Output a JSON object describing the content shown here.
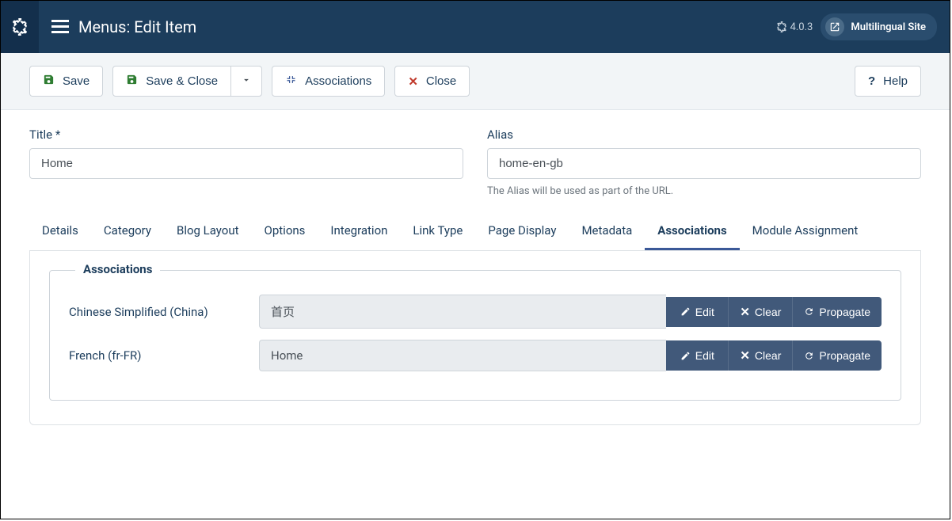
{
  "header": {
    "page_title": "Menus: Edit Item",
    "version": "4.0.3",
    "site_link": "Multilingual Site"
  },
  "toolbar": {
    "save": "Save",
    "save_close": "Save & Close",
    "associations": "Associations",
    "close": "Close",
    "help": "Help"
  },
  "form": {
    "title_label": "Title *",
    "title_value": "Home",
    "alias_label": "Alias",
    "alias_value": "home-en-gb",
    "alias_help": "The Alias will be used as part of the URL."
  },
  "tabs": [
    {
      "label": "Details",
      "active": false
    },
    {
      "label": "Category",
      "active": false
    },
    {
      "label": "Blog Layout",
      "active": false
    },
    {
      "label": "Options",
      "active": false
    },
    {
      "label": "Integration",
      "active": false
    },
    {
      "label": "Link Type",
      "active": false
    },
    {
      "label": "Page Display",
      "active": false
    },
    {
      "label": "Metadata",
      "active": false
    },
    {
      "label": "Associations",
      "active": true
    },
    {
      "label": "Module Assignment",
      "active": false
    }
  ],
  "associations": {
    "legend": "Associations",
    "buttons": {
      "edit": "Edit",
      "clear": "Clear",
      "propagate": "Propagate"
    },
    "rows": [
      {
        "label": "Chinese Simplified (China)",
        "value": "首页"
      },
      {
        "label": "French (fr-FR)",
        "value": "Home"
      }
    ]
  }
}
